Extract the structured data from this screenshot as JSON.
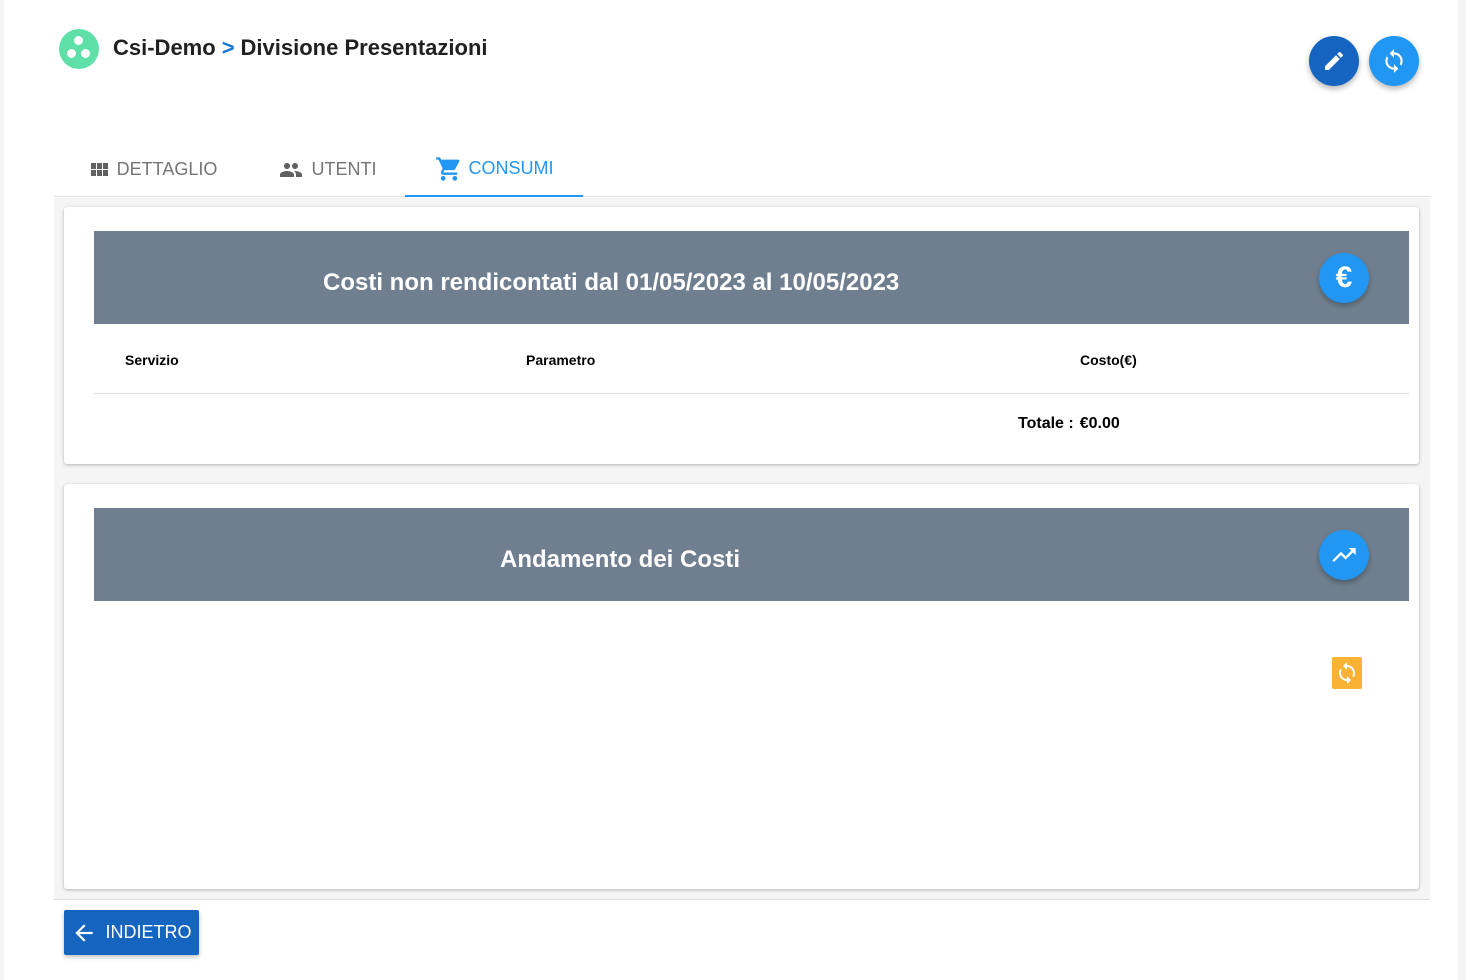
{
  "header": {
    "org": "Csi-Demo",
    "separator": ">",
    "division": "Divisione Presentazioni",
    "logo_icon": "group-circles-icon",
    "actions": [
      {
        "name": "edit",
        "icon": "pencil-icon",
        "color": "#1565c0"
      },
      {
        "name": "refresh",
        "icon": "refresh-icon",
        "color": "#2196f3"
      }
    ]
  },
  "tabs": [
    {
      "label": "DETTAGLIO",
      "icon": "grid-icon",
      "active": false
    },
    {
      "label": "UTENTI",
      "icon": "people-icon",
      "active": false
    },
    {
      "label": "CONSUMI",
      "icon": "cart-icon",
      "active": true
    }
  ],
  "costs_card": {
    "title": "Costi non rendicontati dal 01/05/2023 al 10/05/2023",
    "icon": "euro-icon",
    "icon_glyph": "€",
    "columns": [
      "Servizio",
      "Parametro",
      "Costo(€)"
    ],
    "rows": [],
    "total_label": "Totale :",
    "total_value": "€0.00"
  },
  "trend_card": {
    "title": "Andamento dei Costi",
    "icon": "trending-up-icon",
    "refresh_icon": "refresh-icon"
  },
  "footer": {
    "back_label": "INDIETRO",
    "back_icon": "arrow-left-icon"
  },
  "colors": {
    "accent": "#2196f3",
    "primary_dark": "#1565c0",
    "banner": "#707f8f",
    "logo": "#5fe0a8",
    "warning": "#f9b233"
  }
}
